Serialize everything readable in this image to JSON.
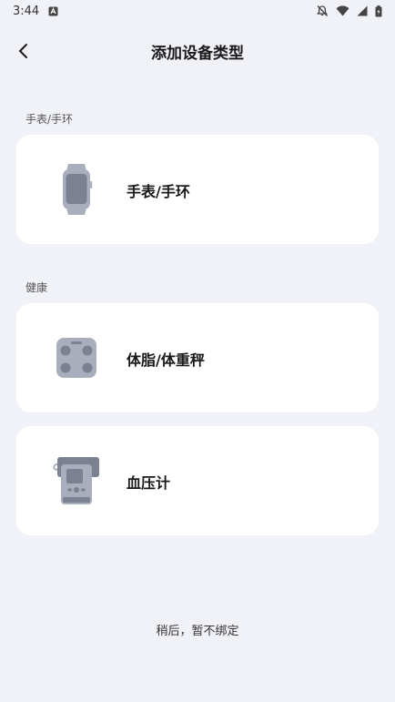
{
  "status_bar": {
    "time": "3:44",
    "icons": [
      "notification-app-icon",
      "mute-icon",
      "wifi-icon",
      "signal-icon",
      "battery-icon"
    ]
  },
  "header": {
    "title": "添加设备类型",
    "back_icon": "chevron-left-icon"
  },
  "sections": [
    {
      "label": "手表/手环",
      "items": [
        {
          "label": "手表/手环",
          "icon": "smartwatch-icon"
        }
      ]
    },
    {
      "label": "健康",
      "items": [
        {
          "label": "体脂/体重秤",
          "icon": "body-scale-icon"
        },
        {
          "label": "血压计",
          "icon": "blood-pressure-monitor-icon"
        }
      ]
    }
  ],
  "footer": {
    "skip_label": "稍后，暂不绑定"
  },
  "colors": {
    "background": "#f1f2f7",
    "card": "#ffffff",
    "icon_gray": "#a9aebc",
    "icon_dark": "#7b8190"
  }
}
